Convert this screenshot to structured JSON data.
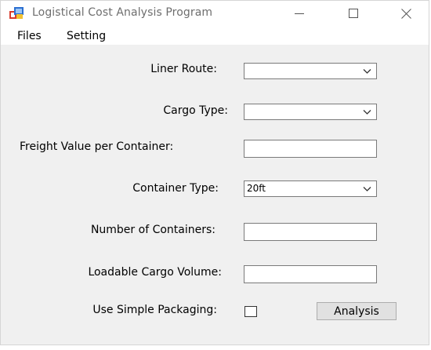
{
  "window": {
    "title": "Logistical Cost Analysis Program"
  },
  "menu": {
    "items": [
      "Files",
      "Setting"
    ]
  },
  "form": {
    "liner_route": {
      "label": "Liner Route:",
      "value": ""
    },
    "cargo_type": {
      "label": "Cargo Type:",
      "value": ""
    },
    "freight_value": {
      "label": "Freight Value per Container:",
      "value": ""
    },
    "container_type": {
      "label": "Container Type:",
      "value": "20ft"
    },
    "num_containers": {
      "label": "Number of Containers:",
      "value": ""
    },
    "cargo_volume": {
      "label": "Loadable Cargo Volume:",
      "value": ""
    },
    "simple_packaging": {
      "label": "Use Simple Packaging:",
      "checked": false
    },
    "analysis_button": "Analysis"
  },
  "colors": {
    "window_bg": "#f0f0f0",
    "title_text": "#6e6e6e",
    "button_bg": "#e1e1e1"
  }
}
